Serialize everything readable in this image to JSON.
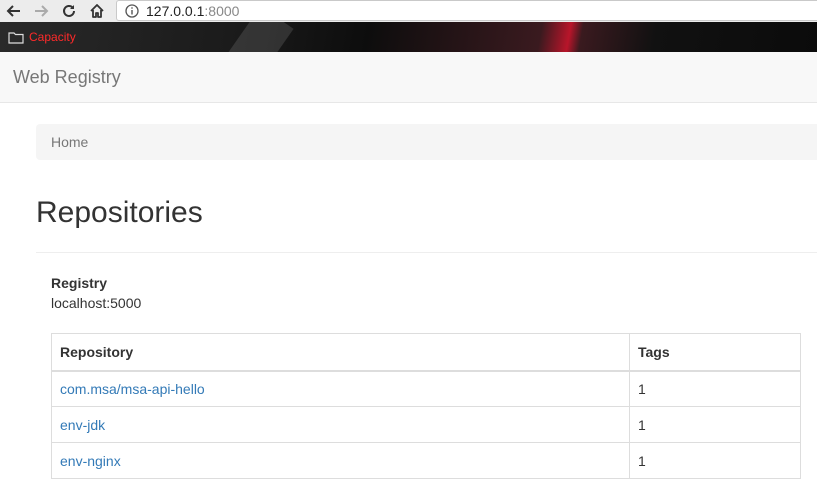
{
  "browser": {
    "url_host": "127.0.0.1",
    "url_port": ":8000",
    "bookmark_label": "Capacity",
    "icons": {
      "back": "arrow-left-icon",
      "forward": "arrow-right-icon",
      "reload": "reload-icon",
      "home": "home-icon",
      "info": "info-icon",
      "folder": "folder-icon"
    },
    "colors": {
      "bookmark_text": "#ff2a2a"
    }
  },
  "navbar": {
    "brand": "Web Registry"
  },
  "breadcrumb": {
    "items": [
      "Home"
    ]
  },
  "page": {
    "title": "Repositories",
    "registry_label": "Registry",
    "registry_value": "localhost:5000"
  },
  "table": {
    "columns": [
      "Repository",
      "Tags"
    ],
    "rows": [
      {
        "repository": "com.msa/msa-api-hello",
        "tags": "1"
      },
      {
        "repository": "env-jdk",
        "tags": "1"
      },
      {
        "repository": "env-nginx",
        "tags": "1"
      }
    ]
  },
  "colors": {
    "link": "#337ab7",
    "navbar_bg": "#f8f8f8",
    "breadcrumb_bg": "#f5f5f5"
  }
}
